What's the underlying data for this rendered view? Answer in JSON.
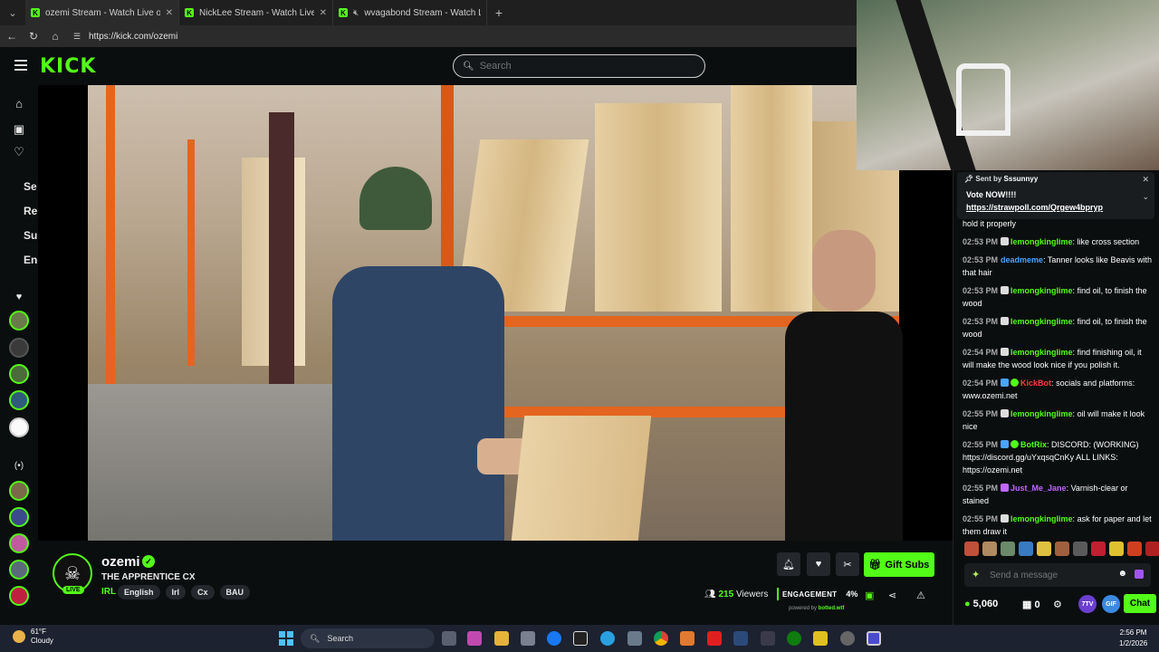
{
  "browser": {
    "tabs": [
      {
        "title": "ozemi Stream - Watch Live on Kick",
        "active": true
      },
      {
        "title": "NickLee Stream - Watch Live on Kick",
        "active": false
      },
      {
        "title": "wvagabond Stream - Watch Live on Kick",
        "active": false
      }
    ],
    "url": "https://kick.com/ozemi"
  },
  "header": {
    "logo": "KICK",
    "search_placeholder": "Search"
  },
  "sidebar": {
    "labels": [
      "Se",
      "Re",
      "Su",
      "En"
    ]
  },
  "channel": {
    "name": "ozemi",
    "live_badge": "LIVE",
    "title": "THE APPRENTICE CX",
    "category": "IRL",
    "tags": [
      "English",
      "Irl",
      "Cx",
      "BAU"
    ],
    "gift_label": "Gift Subs",
    "viewers_count": "215",
    "viewers_label": "Viewers",
    "engagement_label": "ENGAGEMENT",
    "engagement_value": "4%",
    "powered_by": "powered by",
    "powered_brand": "botted.wtf"
  },
  "pinned": {
    "sent_by_label": "Sent by",
    "sent_by_user": "Sssunnyy",
    "text": "Vote NOW!!!!",
    "link": "https://strawpoll.com/Qrgew4bpryp"
  },
  "chat": {
    "partial": "hold it properly",
    "messages": [
      {
        "time": "02:53 PM",
        "user": "lemongkinglime",
        "color": "#53fc18",
        "text": "like cross section"
      },
      {
        "time": "02:53 PM",
        "user": "deadmeme",
        "color": "#4aa3ff",
        "text": "Tanner looks like Beavis with that hair"
      },
      {
        "time": "02:53 PM",
        "user": "lemongkinglime",
        "color": "#53fc18",
        "text": "find oil, to finish the wood"
      },
      {
        "time": "02:53 PM",
        "user": "lemongkinglime",
        "color": "#53fc18",
        "text": "find oil, to finish the wood"
      },
      {
        "time": "02:54 PM",
        "user": "lemongkinglime",
        "color": "#53fc18",
        "text": "find finishing oil, it will make the wood look nice if you polish it."
      },
      {
        "time": "02:54 PM",
        "user": "KickBot",
        "color": "#ff3b3b",
        "text": "socials and platforms: www.ozemi.net"
      },
      {
        "time": "02:55 PM",
        "user": "lemongkinglime",
        "color": "#53fc18",
        "text": "oil will make it look nice"
      },
      {
        "time": "02:55 PM",
        "user": "BotRix",
        "color": "#53fc18",
        "text": "DISCORD: (WORKING) https://discord.gg/uYxqsqCnKy ALL LINKS: https://ozemi.net"
      },
      {
        "time": "02:55 PM",
        "user": "Just_Me_Jane",
        "color": "#c066ff",
        "text": "Varnish-clear or stained"
      },
      {
        "time": "02:55 PM",
        "user": "lemongkinglime",
        "color": "#53fc18",
        "text": "ask for paper and let them draw it"
      }
    ],
    "input_placeholder": "Send a message",
    "points": "5,060",
    "zero": "0",
    "btn_7tv": "7TV",
    "btn_gif": "GIF",
    "chat_button": "Chat"
  },
  "taskbar": {
    "temp": "61°F",
    "condition": "Cloudy",
    "search_label": "Search",
    "time": "2:56 PM",
    "date": "1/2/2026"
  }
}
